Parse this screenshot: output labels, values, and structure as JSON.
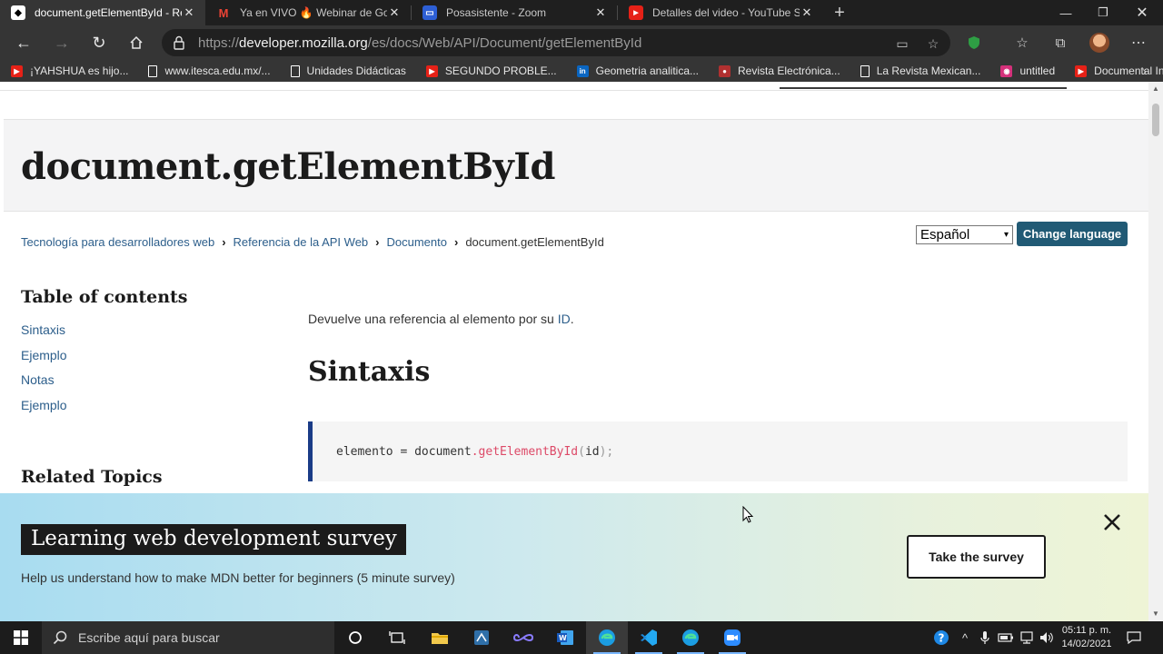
{
  "browser": {
    "tabs": [
      {
        "title": "document.getElementById - Refe",
        "active": true,
        "icon": "mdn-icon"
      },
      {
        "title": "Ya en VIVO 🔥 Webinar de Goog",
        "active": false,
        "icon": "gmail-icon"
      },
      {
        "title": "Posasistente - Zoom",
        "active": false,
        "icon": "zoom-icon"
      },
      {
        "title": "Detalles del video - YouTube Stu",
        "active": false,
        "icon": "youtube-icon"
      }
    ],
    "new_tab": "+",
    "address": {
      "scheme": "https://",
      "host": "developer.mozilla.org",
      "path": "/es/docs/Web/API/Document/getElementById"
    },
    "bookmarks": [
      {
        "label": "¡YAHSHUA es hijo...",
        "icon": "youtube-icon",
        "color": "#e62117"
      },
      {
        "label": "www.itesca.edu.mx/...",
        "icon": "page-icon",
        "color": "#ffffff"
      },
      {
        "label": "Unidades Didácticas",
        "icon": "page-icon",
        "color": "#ffffff"
      },
      {
        "label": "SEGUNDO PROBLE...",
        "icon": "youtube-icon",
        "color": "#e62117"
      },
      {
        "label": "Geometria analitica...",
        "icon": "linkedin-icon",
        "color": "#0a66c2"
      },
      {
        "label": "Revista Electrónica...",
        "icon": "globe-icon",
        "color": "#b03030"
      },
      {
        "label": "La Revista Mexican...",
        "icon": "page-icon",
        "color": "#ffffff"
      },
      {
        "label": "untitled",
        "icon": "app-icon",
        "color": "#d4307a"
      },
      {
        "label": "Documental Investi...",
        "icon": "youtube-icon",
        "color": "#e62117"
      }
    ]
  },
  "page": {
    "title": "document.getElementById",
    "breadcrumb": {
      "items": [
        "Tecnología para desarrolladores web",
        "Referencia de la API Web",
        "Documento"
      ],
      "current": "document.getElementById"
    },
    "language": {
      "selected": "Español",
      "button": "Change language"
    },
    "toc": {
      "title": "Table of contents",
      "items": [
        "Sintaxis",
        "Ejemplo",
        "Notas",
        "Ejemplo"
      ]
    },
    "related_title": "Related Topics",
    "summary": {
      "text": "Devuelve una referencia al elemento por su ",
      "link": "ID",
      "end": "."
    },
    "section_heading": "Sintaxis",
    "code": {
      "var": "elemento = document",
      "fn": ".getElementById",
      "open": "(",
      "arg": "id",
      "close": ");"
    }
  },
  "banner": {
    "title": "Learning web development survey",
    "subtitle": "Help us understand how to make MDN better for beginners (5 minute survey)",
    "button": "Take the survey"
  },
  "taskbar": {
    "search_placeholder": "Escribe aquí para buscar",
    "time": "05:11 p. m.",
    "date": "14/02/2021"
  },
  "colors": {
    "link": "#2c5e8b",
    "lang_button": "#215a75",
    "code_border": "#1a3c87",
    "code_fn": "#dd4a68"
  }
}
